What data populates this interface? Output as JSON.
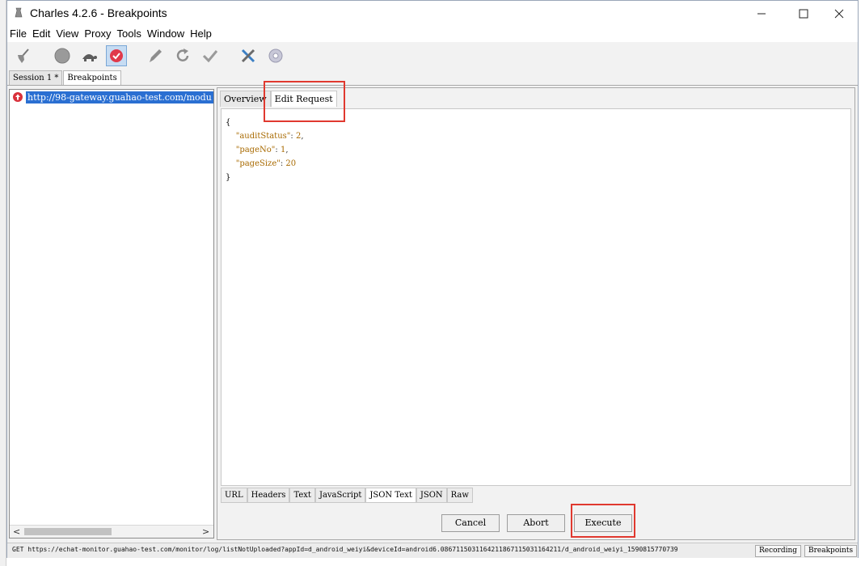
{
  "window": {
    "title": "Charles 4.2.6 - Breakpoints"
  },
  "menu": [
    "File",
    "Edit",
    "View",
    "Proxy",
    "Tools",
    "Window",
    "Help"
  ],
  "toolbar": {
    "icons": [
      "broom-icon",
      "record-icon",
      "throttle-turtle-icon",
      "breakpoints-icon",
      "pen-icon",
      "repeat-icon",
      "validate-check-icon",
      "tools-icon",
      "settings-gear-icon"
    ],
    "active": "breakpoints-icon"
  },
  "session_tabs": [
    "Session 1 *",
    "Breakpoints"
  ],
  "request_list": {
    "url": "http://98-gateway.guahao-test.com/modu"
  },
  "detail_tabs": [
    "Overview",
    "Edit Request"
  ],
  "json_body": {
    "open": "{",
    "lines": [
      {
        "key": "\"auditStatus\"",
        "value": "2",
        "comma": ","
      },
      {
        "key": "\"pageNo\"",
        "value": "1",
        "comma": ","
      },
      {
        "key": "\"pageSize\"",
        "value": "20",
        "comma": ""
      }
    ],
    "close": "}"
  },
  "bottom_tabs": [
    "URL",
    "Headers",
    "Text",
    "JavaScript",
    "JSON Text",
    "JSON",
    "Raw"
  ],
  "buttons": {
    "cancel": "Cancel",
    "abort": "Abort",
    "execute": "Execute"
  },
  "status": {
    "text": "GET https://echat-monitor.guahao-test.com/monitor/log/listNotUploaded?appId=d_android_weiyi&deviceId=android6.0867115031164211867115031164211/d_android_weiyi_1590815770739",
    "recording": "Recording",
    "breakpoints": "Breakpoints"
  },
  "colors": {
    "highlight": "#e0392f",
    "selection": "#2a6fd2",
    "json_value": "#a86a00"
  }
}
